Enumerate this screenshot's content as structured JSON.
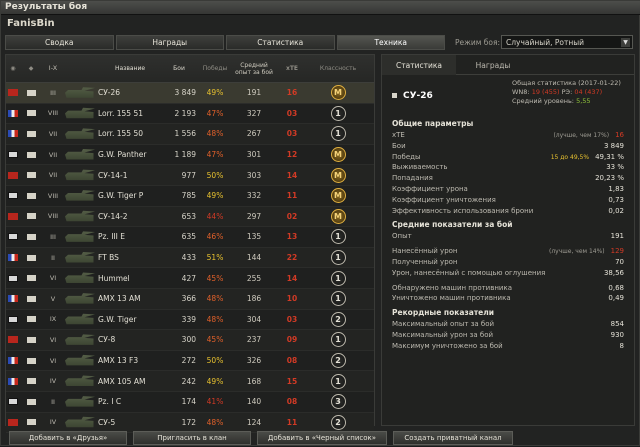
{
  "window": {
    "title": "Результаты боя"
  },
  "player": "FanisBin",
  "tabs": [
    "Сводка",
    "Награды",
    "Статистика",
    "Техника"
  ],
  "mode": {
    "label": "Режим боя:",
    "value": "Случайный, Ротный"
  },
  "columns": {
    "name": "Название",
    "battles": "Бои",
    "wins": "Победы",
    "avg_exp": "Средний опыт за бой",
    "xte": "хТЕ",
    "class": "Классность"
  },
  "rows": [
    {
      "nation": "ussr",
      "tier": "III",
      "name": "СУ-26",
      "battles": "3 849",
      "wins": "49%",
      "wins_color": "#e7c12f",
      "exp": "191",
      "xte": "16",
      "xte_color": "#d23a25",
      "badge": "M"
    },
    {
      "nation": "france",
      "tier": "VIII",
      "name": "Lorr. 155 51",
      "battles": "2 193",
      "wins": "47%",
      "wins_color": "#e0602a",
      "exp": "327",
      "xte": "03",
      "xte_color": "#d23a25",
      "badge": "1"
    },
    {
      "nation": "france",
      "tier": "VII",
      "name": "Lorr. 155 50",
      "battles": "1 556",
      "wins": "48%",
      "wins_color": "#e0602a",
      "exp": "267",
      "xte": "03",
      "xte_color": "#d23a25",
      "badge": "1"
    },
    {
      "nation": "germany",
      "tier": "VII",
      "name": "G.W. Panther",
      "battles": "1 189",
      "wins": "47%",
      "wins_color": "#e0602a",
      "exp": "301",
      "xte": "12",
      "xte_color": "#d23a25",
      "badge": "M"
    },
    {
      "nation": "ussr",
      "tier": "VII",
      "name": "СУ-14-1",
      "battles": "977",
      "wins": "50%",
      "wins_color": "#e7c12f",
      "exp": "303",
      "xte": "14",
      "xte_color": "#d23a25",
      "badge": "M"
    },
    {
      "nation": "germany",
      "tier": "VIII",
      "name": "G.W. Tiger P",
      "battles": "785",
      "wins": "49%",
      "wins_color": "#e7c12f",
      "exp": "332",
      "xte": "11",
      "xte_color": "#d23a25",
      "badge": "M"
    },
    {
      "nation": "ussr",
      "tier": "VIII",
      "name": "СУ-14-2",
      "battles": "653",
      "wins": "44%",
      "wins_color": "#d23a25",
      "exp": "297",
      "xte": "02",
      "xte_color": "#d23a25",
      "badge": "M"
    },
    {
      "nation": "germany",
      "tier": "III",
      "name": "Pz. III E",
      "battles": "635",
      "wins": "46%",
      "wins_color": "#e0602a",
      "exp": "135",
      "xte": "13",
      "xte_color": "#d23a25",
      "badge": "1"
    },
    {
      "nation": "france",
      "tier": "II",
      "name": "FT BS",
      "battles": "433",
      "wins": "51%",
      "wins_color": "#e7c12f",
      "exp": "144",
      "xte": "22",
      "xte_color": "#d23a25",
      "badge": "1"
    },
    {
      "nation": "germany",
      "tier": "VI",
      "name": "Hummel",
      "battles": "427",
      "wins": "45%",
      "wins_color": "#e0602a",
      "exp": "255",
      "xte": "14",
      "xte_color": "#d23a25",
      "badge": "1"
    },
    {
      "nation": "france",
      "tier": "V",
      "name": "AMX 13 AM",
      "battles": "366",
      "wins": "48%",
      "wins_color": "#e0602a",
      "exp": "186",
      "xte": "10",
      "xte_color": "#d23a25",
      "badge": "1"
    },
    {
      "nation": "germany",
      "tier": "IX",
      "name": "G.W. Tiger",
      "battles": "339",
      "wins": "48%",
      "wins_color": "#e0602a",
      "exp": "304",
      "xte": "03",
      "xte_color": "#d23a25",
      "badge": "2"
    },
    {
      "nation": "ussr",
      "tier": "VI",
      "name": "СУ-8",
      "battles": "300",
      "wins": "45%",
      "wins_color": "#e0602a",
      "exp": "237",
      "xte": "09",
      "xte_color": "#d23a25",
      "badge": "1"
    },
    {
      "nation": "france",
      "tier": "VI",
      "name": "AMX 13 F3",
      "battles": "272",
      "wins": "50%",
      "wins_color": "#e7c12f",
      "exp": "326",
      "xte": "08",
      "xte_color": "#d23a25",
      "badge": "2"
    },
    {
      "nation": "france",
      "tier": "IV",
      "name": "AMX 105 AM",
      "battles": "242",
      "wins": "49%",
      "wins_color": "#e7c12f",
      "exp": "168",
      "xte": "15",
      "xte_color": "#d23a25",
      "badge": "1"
    },
    {
      "nation": "germany",
      "tier": "II",
      "name": "Pz. I C",
      "battles": "174",
      "wins": "41%",
      "wins_color": "#d23a25",
      "exp": "140",
      "xte": "08",
      "xte_color": "#d23a25",
      "badge": "3"
    },
    {
      "nation": "ussr",
      "tier": "IV",
      "name": "СУ-5",
      "battles": "172",
      "wins": "48%",
      "wins_color": "#e0602a",
      "exp": "124",
      "xte": "11",
      "xte_color": "#d23a25",
      "badge": "2"
    }
  ],
  "right": {
    "tabs": [
      "Статистика",
      "Награды"
    ],
    "tank": "СУ-26",
    "overall_title": "Общая статистика (2017-01-22)",
    "wn8_label": "WN8:",
    "wn8": "19 (455)",
    "pr_label": "РЭ:",
    "pr": "04 (437)",
    "avg_level_label": "Средний уровень:",
    "avg_level": "5,55",
    "sections": [
      {
        "title": "Общие параметры",
        "items": [
          {
            "k": "хТЕ",
            "note": "(лучше, чем 17%)",
            "v": "16",
            "color": "#d23a25"
          },
          {
            "k": "Бои",
            "note": "",
            "v": "3 849",
            "color": "#e6e3d8"
          },
          {
            "k": "Победы",
            "note": "15 до 49,5%",
            "v": "49,31 %",
            "color": "#e6e3d8"
          },
          {
            "k": "Выживаемость",
            "note": "",
            "v": "33 %",
            "color": "#e6e3d8"
          },
          {
            "k": "Попадания",
            "note": "",
            "v": "20,23 %",
            "color": "#e6e3d8"
          },
          {
            "k": "Коэффициент урона",
            "note": "",
            "v": "1,83",
            "color": "#e6e3d8"
          },
          {
            "k": "Коэффициент уничтожения",
            "note": "",
            "v": "0,73",
            "color": "#e6e3d8"
          },
          {
            "k": "Эффективность использования брони",
            "note": "",
            "v": "0,02",
            "color": "#e6e3d8"
          }
        ]
      },
      {
        "title": "Средние показатели за бой",
        "items": [
          {
            "k": "Опыт",
            "note": "",
            "v": "191",
            "color": "#e6e3d8"
          },
          {
            "k": "",
            "note": "",
            "v": "",
            "color": "#e6e3d8"
          },
          {
            "k": "Нанесённый урон",
            "note": "(лучше, чем 14%)",
            "v": "129",
            "color": "#d23a25"
          },
          {
            "k": "Полученный урон",
            "note": "",
            "v": "70",
            "color": "#e6e3d8"
          },
          {
            "k": "Урон, нанесённый с помощью оглушения",
            "note": "",
            "v": "38,56",
            "color": "#e6e3d8"
          },
          {
            "k": "",
            "note": "",
            "v": "",
            "color": "#e6e3d8"
          },
          {
            "k": "Обнаружено машин противника",
            "note": "",
            "v": "0,68",
            "color": "#e6e3d8"
          },
          {
            "k": "Уничтожено машин противника",
            "note": "",
            "v": "0,49",
            "color": "#e6e3d8"
          }
        ]
      },
      {
        "title": "Рекордные показатели",
        "items": [
          {
            "k": "Максимальный опыт за бой",
            "note": "",
            "v": "854",
            "color": "#e6e3d8"
          },
          {
            "k": "Максимальный урон за бой",
            "note": "",
            "v": "930",
            "color": "#e6e3d8"
          },
          {
            "k": "Максимум уничтожено за бой",
            "note": "",
            "v": "8",
            "color": "#e6e3d8"
          }
        ]
      }
    ]
  },
  "buttons": [
    "Добавить в «Друзья»",
    "Пригласить в клан",
    "Добавить в «Черный список»",
    "Создать приватный канал"
  ]
}
